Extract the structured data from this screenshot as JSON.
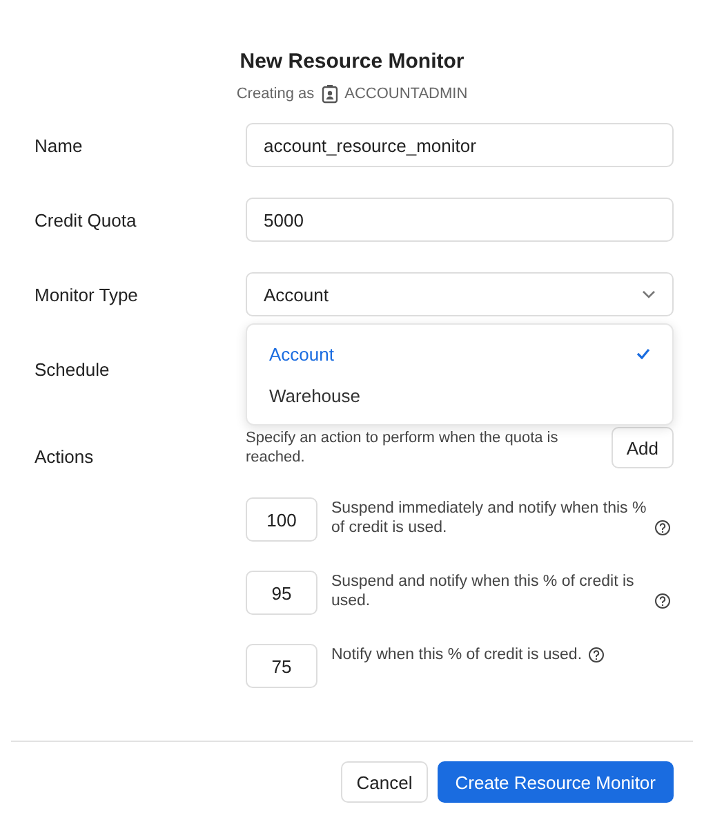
{
  "title": "New Resource Monitor",
  "subtitle": {
    "prefix": "Creating as",
    "role": "ACCOUNTADMIN"
  },
  "fields": [
    {
      "label": "Name",
      "kind": "text",
      "value": "account_resource_monitor"
    },
    {
      "label": "Credit Quota",
      "kind": "text",
      "value": "5000"
    },
    {
      "label": "Monitor Type",
      "kind": "select",
      "value": "Account",
      "expanded": true,
      "options": [
        {
          "label": "Account",
          "selected": true
        },
        {
          "label": "Warehouse",
          "selected": false
        }
      ]
    },
    {
      "label": "Schedule",
      "kind": "hidden"
    }
  ],
  "actions": {
    "label": "Actions",
    "description": "Specify an action to perform when the quota is reached.",
    "add_button": "Add",
    "items": [
      {
        "value": "100",
        "text": "Suspend immediately and notify when this % of credit is used."
      },
      {
        "value": "95",
        "text": "Suspend and notify when this % of credit is used."
      },
      {
        "value": "75",
        "text": "Notify when this % of credit is used."
      }
    ]
  },
  "buttons": [
    {
      "label": "Cancel",
      "kind": "secondary"
    },
    {
      "label": "Create Resource Monitor",
      "kind": "primary"
    }
  ]
}
